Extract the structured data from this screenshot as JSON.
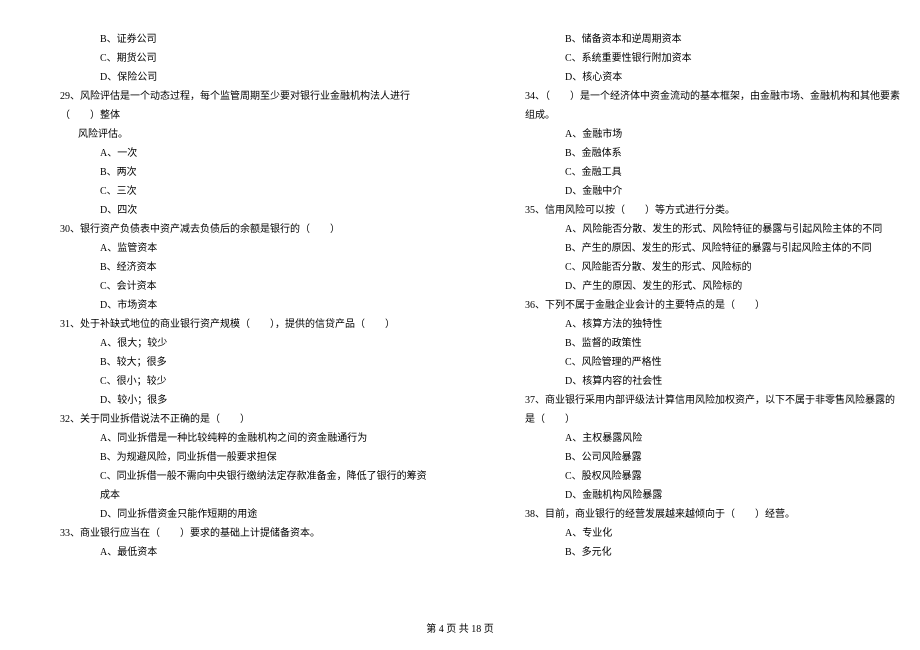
{
  "left": {
    "opt_b28": "B、证券公司",
    "opt_c28": "C、期货公司",
    "opt_d28": "D、保险公司",
    "q29": "29、风险评估是一个动态过程，每个监管周期至少要对银行业金融机构法人进行（　　）整体",
    "q29_cont": "风险评估。",
    "q29a": "A、一次",
    "q29b": "B、两次",
    "q29c": "C、三次",
    "q29d": "D、四次",
    "q30": "30、银行资产负债表中资产减去负债后的余额是银行的（　　）",
    "q30a": "A、监管资本",
    "q30b": "B、经济资本",
    "q30c": "C、会计资本",
    "q30d": "D、市场资本",
    "q31": "31、处于补缺式地位的商业银行资产规模（　　），提供的信贷产品（　　）",
    "q31a": "A、很大；较少",
    "q31b": "B、较大；很多",
    "q31c": "C、很小；较少",
    "q31d": "D、较小；很多",
    "q32": "32、关于同业拆借说法不正确的是（　　）",
    "q32a": "A、同业拆借是一种比较纯粹的金融机构之间的资金融通行为",
    "q32b": "B、为规避风险，同业拆借一般要求担保",
    "q32c": "C、同业拆借一般不需向中央银行缴纳法定存款准备金，降低了银行的筹资成本",
    "q32d": "D、同业拆借资金只能作短期的用途",
    "q33": "33、商业银行应当在（　　）要求的基础上计提储备资本。",
    "q33a": "A、最低资本"
  },
  "right": {
    "opt_b33": "B、储备资本和逆周期资本",
    "opt_c33": "C、系统重要性银行附加资本",
    "opt_d33": "D、核心资本",
    "q34": "34、（　　）是一个经济体中资金流动的基本框架，由金融市场、金融机构和其他要素组成。",
    "q34a": "A、金融市场",
    "q34b": "B、金融体系",
    "q34c": "C、金融工具",
    "q34d": "D、金融中介",
    "q35": "35、信用风险可以按（　　）等方式进行分类。",
    "q35a": "A、风险能否分散、发生的形式、风险特征的暴露与引起风险主体的不同",
    "q35b": "B、产生的原因、发生的形式、风险特征的暴露与引起风险主体的不同",
    "q35c": "C、风险能否分散、发生的形式、风险标的",
    "q35d": "D、产生的原因、发生的形式、风险标的",
    "q36": "36、下列不属于金融企业会计的主要特点的是（　　）",
    "q36a": "A、核算方法的独特性",
    "q36b": "B、监督的政策性",
    "q36c": "C、风险管理的严格性",
    "q36d": "D、核算内容的社会性",
    "q37": "37、商业银行采用内部评级法计算信用风险加权资产，以下不属于非零售风险暴露的是（　　）",
    "q37a": "A、主权暴露风险",
    "q37b": "B、公司风险暴露",
    "q37c": "C、股权风险暴露",
    "q37d": "D、金融机构风险暴露",
    "q38": "38、目前，商业银行的经营发展越来越倾向于（　　）经营。",
    "q38a": "A、专业化",
    "q38b": "B、多元化"
  },
  "footer": "第 4 页 共 18 页"
}
